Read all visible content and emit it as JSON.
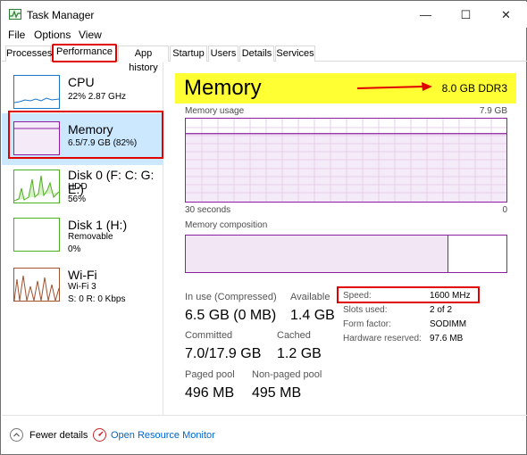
{
  "window": {
    "title": "Task Manager",
    "controls": {
      "minimize": "—",
      "maximize": "☐",
      "close": "✕"
    }
  },
  "menu": [
    "File",
    "Options",
    "View"
  ],
  "tabs": [
    "Processes",
    "Performance",
    "App history",
    "Startup",
    "Users",
    "Details",
    "Services"
  ],
  "active_tab": "Performance",
  "sidebar": [
    {
      "name": "CPU",
      "line1": "22%  2.87 GHz",
      "line2": "",
      "color": "#1a75c8"
    },
    {
      "name": "Memory",
      "line1": "6.5/7.9 GB (82%)",
      "line2": "",
      "color": "#8b1fa0",
      "selected": true
    },
    {
      "name": "Disk 0 (F: C: G: E:)",
      "line1": "HDD",
      "line2": "56%",
      "color": "#4caf1f"
    },
    {
      "name": "Disk 1 (H:)",
      "line1": "Removable",
      "line2": "0%",
      "color": "#4caf1f"
    },
    {
      "name": "Wi-Fi",
      "line1": "Wi-Fi 3",
      "line2": "S: 0  R: 0 Kbps",
      "color": "#a0522d"
    }
  ],
  "detail": {
    "title": "Memory",
    "spec": "8.0 GB DDR3",
    "usage_label": "Memory usage",
    "usage_max": "7.9 GB",
    "usage_fraction": 0.82,
    "time_left": "30 seconds",
    "time_right": "0",
    "composition_label": "Memory composition",
    "composition_in_use_fraction": 0.82,
    "stats": {
      "in_use_label": "In use (Compressed)",
      "in_use_value": "6.5 GB (0 MB)",
      "available_label": "Available",
      "available_value": "1.4 GB",
      "committed_label": "Committed",
      "committed_value": "7.0/17.9 GB",
      "cached_label": "Cached",
      "cached_value": "1.2 GB",
      "paged_label": "Paged pool",
      "paged_value": "496 MB",
      "nonpaged_label": "Non-paged pool",
      "nonpaged_value": "495 MB"
    },
    "hardware": [
      {
        "label": "Speed:",
        "value": "1600 MHz"
      },
      {
        "label": "Slots used:",
        "value": "2 of 2"
      },
      {
        "label": "Form factor:",
        "value": "SODIMM"
      },
      {
        "label": "Hardware reserved:",
        "value": "97.6 MB"
      }
    ]
  },
  "footer": {
    "fewer_details": "Fewer details",
    "open_resource_monitor": "Open Resource Monitor"
  },
  "colors": {
    "accent_red": "#e00000",
    "highlight_yellow": "#ffff33",
    "memory_purple": "#8b1fa0",
    "selected_bg": "#cce8ff"
  }
}
